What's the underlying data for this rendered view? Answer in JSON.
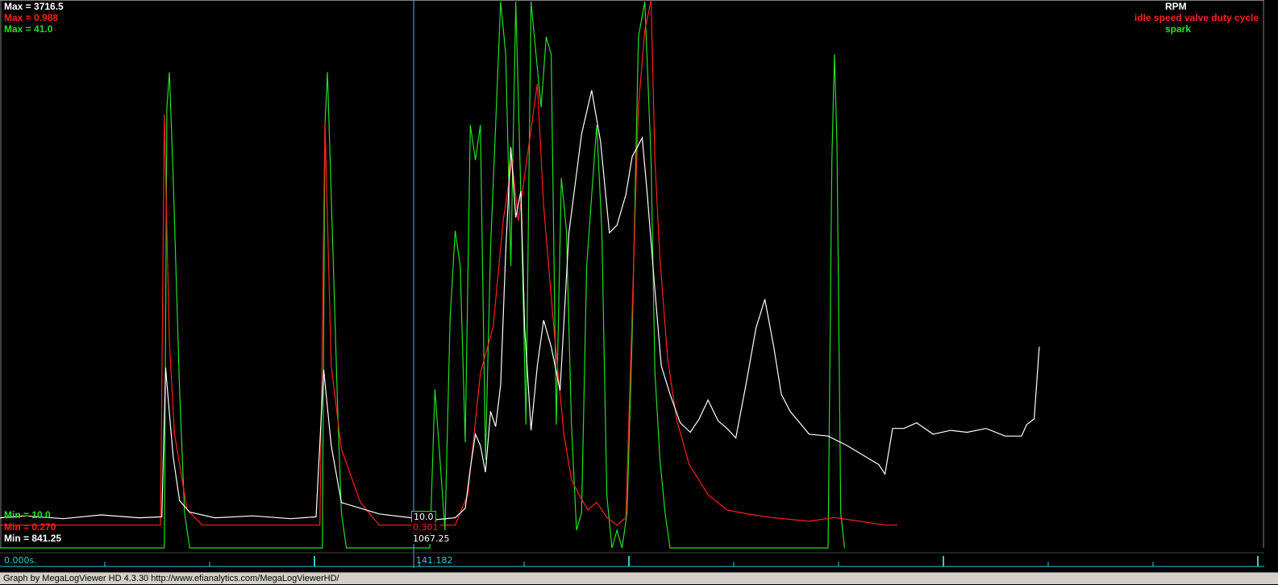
{
  "colors": {
    "rpm": "#ffffff",
    "idle": "#ff1e1e",
    "spark": "#22e022",
    "cursor": "#33c8d8",
    "axis": "#33c8d8",
    "background": "#000000"
  },
  "legend": {
    "rpm": "RPM",
    "idle": "idle speed valve duty cycle",
    "spark": "spark"
  },
  "scale_labels": {
    "rpm_max": "Max = 3716.5",
    "idle_max": "Max = 0.988",
    "spark_max": "Max = 41.0",
    "spark_min": "Min = 10.0",
    "idle_min": "Min = 0.270",
    "rpm_min": "Min = 841.25"
  },
  "cursor": {
    "time_label": "141.182",
    "spark_value": "10.0",
    "idle_value": "0.301",
    "rpm_value": "1067.25"
  },
  "timeline": {
    "start_label": "0.000s."
  },
  "footer": {
    "text": "Graph by MegaLogViewer HD 4.3.30 http://www.efianalytics.com/MegaLogViewerHD/"
  },
  "chart_data": {
    "type": "line",
    "x_range": [
      0,
      1
    ],
    "series": [
      {
        "name": "RPM",
        "ylim": [
          841.25,
          3716.5
        ],
        "points": [
          [
            0.0,
            1000
          ],
          [
            0.02,
            1010
          ],
          [
            0.05,
            995
          ],
          [
            0.08,
            1015
          ],
          [
            0.11,
            1000
          ],
          [
            0.128,
            1005
          ],
          [
            0.131,
            1790
          ],
          [
            0.134,
            1550
          ],
          [
            0.137,
            1320
          ],
          [
            0.142,
            1090
          ],
          [
            0.15,
            1030
          ],
          [
            0.17,
            1000
          ],
          [
            0.2,
            1010
          ],
          [
            0.23,
            995
          ],
          [
            0.25,
            1005
          ],
          [
            0.256,
            1780
          ],
          [
            0.262,
            1380
          ],
          [
            0.27,
            1080
          ],
          [
            0.29,
            1040
          ],
          [
            0.3,
            1020
          ],
          [
            0.325,
            1000
          ],
          [
            0.345,
            990
          ],
          [
            0.36,
            1000
          ],
          [
            0.368,
            1050
          ],
          [
            0.372,
            1260
          ],
          [
            0.376,
            1440
          ],
          [
            0.38,
            1380
          ],
          [
            0.384,
            1240
          ],
          [
            0.388,
            1560
          ],
          [
            0.392,
            1480
          ],
          [
            0.396,
            1700
          ],
          [
            0.4,
            2400
          ],
          [
            0.404,
            2950
          ],
          [
            0.408,
            2580
          ],
          [
            0.412,
            2720
          ],
          [
            0.415,
            2000
          ],
          [
            0.42,
            1460
          ],
          [
            0.425,
            1800
          ],
          [
            0.43,
            2040
          ],
          [
            0.436,
            1900
          ],
          [
            0.443,
            1670
          ],
          [
            0.45,
            2500
          ],
          [
            0.46,
            3020
          ],
          [
            0.468,
            3250
          ],
          [
            0.475,
            2980
          ],
          [
            0.482,
            2500
          ],
          [
            0.488,
            2540
          ],
          [
            0.495,
            2700
          ],
          [
            0.5,
            2900
          ],
          [
            0.508,
            3000
          ],
          [
            0.512,
            2700
          ],
          [
            0.518,
            2200
          ],
          [
            0.523,
            1800
          ],
          [
            0.53,
            1650
          ],
          [
            0.538,
            1500
          ],
          [
            0.546,
            1450
          ],
          [
            0.553,
            1520
          ],
          [
            0.56,
            1620
          ],
          [
            0.568,
            1510
          ],
          [
            0.575,
            1470
          ],
          [
            0.582,
            1420
          ],
          [
            0.59,
            1700
          ],
          [
            0.598,
            2000
          ],
          [
            0.605,
            2150
          ],
          [
            0.612,
            1900
          ],
          [
            0.618,
            1650
          ],
          [
            0.625,
            1560
          ],
          [
            0.64,
            1440
          ],
          [
            0.655,
            1430
          ],
          [
            0.67,
            1380
          ],
          [
            0.685,
            1320
          ],
          [
            0.695,
            1280
          ],
          [
            0.7,
            1230
          ],
          [
            0.706,
            1470
          ],
          [
            0.715,
            1470
          ],
          [
            0.725,
            1500
          ],
          [
            0.738,
            1440
          ],
          [
            0.752,
            1460
          ],
          [
            0.765,
            1450
          ],
          [
            0.78,
            1470
          ],
          [
            0.795,
            1430
          ],
          [
            0.808,
            1430
          ],
          [
            0.812,
            1490
          ],
          [
            0.818,
            1520
          ],
          [
            0.822,
            1900
          ]
        ]
      },
      {
        "name": "idle speed valve duty cycle",
        "ylim": [
          0.27,
          0.988
        ],
        "points": [
          [
            0.0,
            0.3
          ],
          [
            0.127,
            0.3
          ],
          [
            0.13,
            0.84
          ],
          [
            0.134,
            0.54
          ],
          [
            0.138,
            0.42
          ],
          [
            0.148,
            0.32
          ],
          [
            0.16,
            0.3
          ],
          [
            0.253,
            0.3
          ],
          [
            0.257,
            0.83
          ],
          [
            0.262,
            0.51
          ],
          [
            0.27,
            0.4
          ],
          [
            0.285,
            0.33
          ],
          [
            0.3,
            0.3
          ],
          [
            0.36,
            0.3
          ],
          [
            0.37,
            0.34
          ],
          [
            0.38,
            0.5
          ],
          [
            0.39,
            0.56
          ],
          [
            0.398,
            0.7
          ],
          [
            0.405,
            0.78
          ],
          [
            0.41,
            0.7
          ],
          [
            0.42,
            0.82
          ],
          [
            0.425,
            0.88
          ],
          [
            0.43,
            0.72
          ],
          [
            0.438,
            0.56
          ],
          [
            0.446,
            0.42
          ],
          [
            0.452,
            0.36
          ],
          [
            0.458,
            0.34
          ],
          [
            0.465,
            0.32
          ],
          [
            0.472,
            0.33
          ],
          [
            0.48,
            0.31
          ],
          [
            0.488,
            0.3
          ],
          [
            0.495,
            0.31
          ],
          [
            0.505,
            0.85
          ],
          [
            0.51,
            0.95
          ],
          [
            0.515,
            0.99
          ],
          [
            0.518,
            0.78
          ],
          [
            0.522,
            0.65
          ],
          [
            0.528,
            0.52
          ],
          [
            0.535,
            0.44
          ],
          [
            0.545,
            0.38
          ],
          [
            0.56,
            0.34
          ],
          [
            0.575,
            0.32
          ],
          [
            0.59,
            0.315
          ],
          [
            0.61,
            0.31
          ],
          [
            0.64,
            0.305
          ],
          [
            0.66,
            0.31
          ],
          [
            0.68,
            0.305
          ],
          [
            0.7,
            0.3
          ],
          [
            0.71,
            0.3
          ]
        ]
      },
      {
        "name": "spark",
        "ylim": [
          10.0,
          41.0
        ],
        "points": [
          [
            0.0,
            10
          ],
          [
            0.13,
            10
          ],
          [
            0.132,
            35
          ],
          [
            0.134,
            37
          ],
          [
            0.137,
            31
          ],
          [
            0.142,
            19
          ],
          [
            0.146,
            12
          ],
          [
            0.15,
            10
          ],
          [
            0.255,
            10
          ],
          [
            0.257,
            34
          ],
          [
            0.259,
            37
          ],
          [
            0.262,
            30
          ],
          [
            0.267,
            18
          ],
          [
            0.27,
            12
          ],
          [
            0.274,
            10
          ],
          [
            0.34,
            10
          ],
          [
            0.344,
            19
          ],
          [
            0.348,
            15
          ],
          [
            0.352,
            11
          ],
          [
            0.356,
            23
          ],
          [
            0.36,
            28
          ],
          [
            0.364,
            26
          ],
          [
            0.368,
            16
          ],
          [
            0.372,
            34
          ],
          [
            0.376,
            32
          ],
          [
            0.38,
            34
          ],
          [
            0.384,
            15
          ],
          [
            0.388,
            27
          ],
          [
            0.392,
            34
          ],
          [
            0.396,
            41
          ],
          [
            0.4,
            38
          ],
          [
            0.404,
            26
          ],
          [
            0.408,
            41
          ],
          [
            0.412,
            30
          ],
          [
            0.416,
            17
          ],
          [
            0.42,
            41
          ],
          [
            0.424,
            38
          ],
          [
            0.428,
            35
          ],
          [
            0.432,
            39
          ],
          [
            0.436,
            38
          ],
          [
            0.44,
            17
          ],
          [
            0.444,
            31
          ],
          [
            0.448,
            28
          ],
          [
            0.452,
            17
          ],
          [
            0.456,
            11
          ],
          [
            0.46,
            12
          ],
          [
            0.464,
            26
          ],
          [
            0.468,
            30
          ],
          [
            0.472,
            34
          ],
          [
            0.476,
            28
          ],
          [
            0.48,
            13
          ],
          [
            0.484,
            10
          ],
          [
            0.488,
            11
          ],
          [
            0.492,
            10
          ],
          [
            0.496,
            12
          ],
          [
            0.5,
            22
          ],
          [
            0.505,
            39
          ],
          [
            0.51,
            41
          ],
          [
            0.515,
            32
          ],
          [
            0.518,
            20
          ],
          [
            0.522,
            15
          ],
          [
            0.526,
            12
          ],
          [
            0.53,
            10
          ],
          [
            0.6,
            10
          ],
          [
            0.64,
            10
          ],
          [
            0.655,
            10
          ],
          [
            0.658,
            32
          ],
          [
            0.66,
            38
          ],
          [
            0.662,
            33
          ],
          [
            0.665,
            12
          ],
          [
            0.668,
            10
          ]
        ]
      }
    ]
  }
}
